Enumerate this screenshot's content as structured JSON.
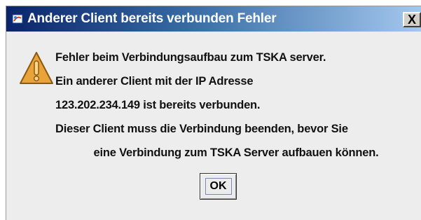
{
  "window": {
    "title": "Anderer Client bereits verbunden Fehler",
    "close_label": "X",
    "app_icon": "java-cup-icon"
  },
  "dialog": {
    "icon": "warning-icon",
    "icon_symbol": "!",
    "message_lines": [
      "Fehler beim Verbindungsaufbau zum TSKA server.",
      "Ein anderer Client mit der IP Adresse",
      "123.202.234.149 ist bereits verbunden.",
      "Dieser Client muss die Verbindung beenden, bevor Sie",
      "eine Verbindung zum TSKA Server aufbauen können."
    ],
    "ok_label": "OK"
  },
  "colors": {
    "titlebar_start": "#0a246a",
    "titlebar_end": "#a6caf0",
    "dialog_background": "#ededed",
    "warning_fill": "#e9a33a",
    "warning_stroke": "#8a5a10"
  }
}
